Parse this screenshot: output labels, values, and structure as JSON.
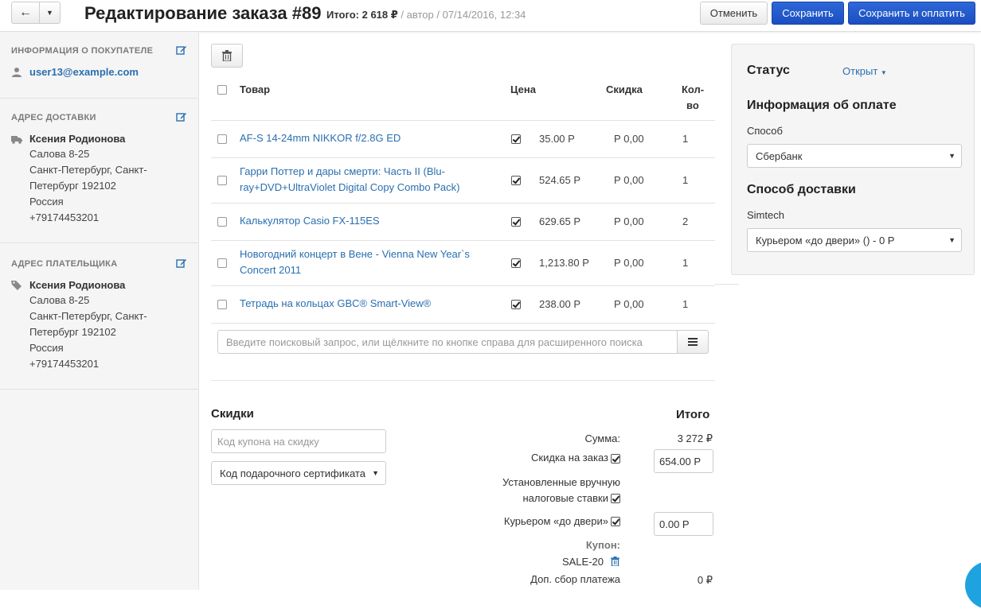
{
  "header": {
    "title": "Редактирование заказа #89",
    "total_label": "Итого: 2 618 ₽",
    "meta": " / автор / 07/14/2016, 12:34",
    "cancel_label": "Отменить",
    "save_label": "Сохранить",
    "save_pay_label": "Сохранить и оплатить"
  },
  "sidebar": {
    "customer": {
      "heading": "Информация о покупателе",
      "email": "user13@example.com"
    },
    "shipping": {
      "heading": "Адрес доставки",
      "name": "Ксения Родионова",
      "lines": [
        "Салова 8-25",
        "Санкт-Петербург, Санкт-",
        "Петербург 192102",
        "Россия",
        "+79174453201"
      ]
    },
    "billing": {
      "heading": "Адрес плательщика",
      "name": "Ксения Родионова",
      "lines": [
        "Салова 8-25",
        "Санкт-Петербург, Санкт-",
        "Петербург 192102",
        "Россия",
        "+79174453201"
      ]
    }
  },
  "products": {
    "columns": {
      "product": "Товар",
      "price": "Цена",
      "discount": "Скидка",
      "qty_line1": "Кол-",
      "qty_line2": "во"
    },
    "rows": [
      {
        "name": "AF-S 14-24mm NIKKOR f/2.8G ED",
        "price": "35.00 Р",
        "discount": "Р 0,00",
        "qty": "1"
      },
      {
        "name": "Гарри Поттер и дары смерти: Часть II (Blu-ray+DVD+UltraViolet Digital Copy Combo Pack)",
        "price": "524.65 Р",
        "discount": "Р 0,00",
        "qty": "1"
      },
      {
        "name": "Калькулятор Casio FX-115ES",
        "price": "629.65 Р",
        "discount": "Р 0,00",
        "qty": "2"
      },
      {
        "name": "Новогодний концерт в Вене - Vienna New Year`s Concert 2011",
        "price": "1,213.80 Р",
        "discount": "Р 0,00",
        "qty": "1"
      },
      {
        "name": "Тетрадь на кольцах GBC® Smart-View®",
        "price": "238.00 Р",
        "discount": "Р 0,00",
        "qty": "1"
      }
    ],
    "search_placeholder": "Введите поисковый запрос, или щёлкните по кнопке справа для расширенного поиска"
  },
  "discounts": {
    "title": "Скидки",
    "coupon_placeholder": "Код купона на скидку",
    "gift_cert_label": "Код подарочного сертификата"
  },
  "totals": {
    "title": "Итого",
    "subtotal_label": "Сумма:",
    "subtotal_value": "3 272 ₽",
    "order_discount_label": "Скидка на заказ",
    "order_discount_value": "654.00 Р",
    "manual_tax_line1": "Установленные вручную",
    "manual_tax_line2": "налоговые ставки",
    "shipping_label": "Курьером «до двери»",
    "shipping_value": "0.00 Р",
    "coupon_label": "Купон:",
    "coupon_code": "SALE-20",
    "payment_fee_label": "Доп. сбор платежа",
    "payment_fee_value": "0 ₽"
  },
  "right_panel": {
    "status_title": "Статус",
    "status_value": "Открыт",
    "payment_title": "Информация об оплате",
    "method_label": "Способ",
    "method_value": "Сбербанк",
    "shipping_title": "Способ доставки",
    "carrier_label": "Simtech",
    "shipping_value": "Курьером «до двери» () - 0 Р"
  },
  "colors": {
    "primary": "#1f56c9",
    "link": "#2a6fb0",
    "sidebar_bg": "#f5f5f5"
  }
}
